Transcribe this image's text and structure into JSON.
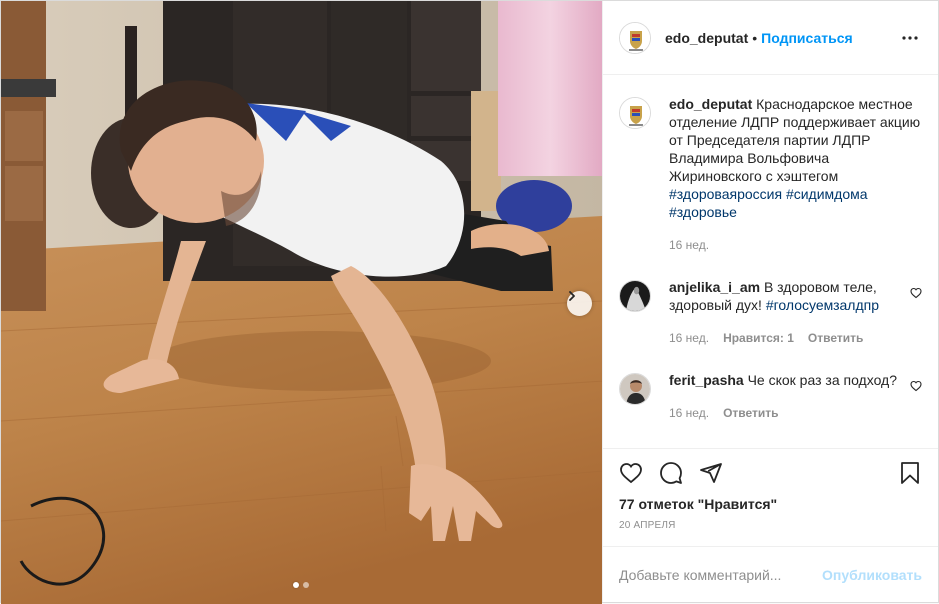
{
  "post": {
    "author": "edo_deputat",
    "separator": "•",
    "follow_label": "Подписаться",
    "more_icon": "more-horizontal-icon"
  },
  "caption": {
    "user": "edo_deputat",
    "text": "Краснодарское местное отделение ЛДПР поддерживает акцию от Председателя партии ЛДПР Владимира Вольфовича Жириновского с хэштегом",
    "hashtags": [
      "#здороваяроссия",
      "#сидимдома",
      "#здоровье"
    ],
    "time": "16 нед."
  },
  "comments": [
    {
      "user": "anjelika_i_am",
      "text": "В здоровом теле, здоровый дух!",
      "hashtag": "#голосуемзалдпр",
      "time": "16 нед.",
      "likes": "Нравится: 1",
      "reply": "Ответить"
    },
    {
      "user": "ferit_pasha",
      "text": "Че скок раз за подход?",
      "time": "16 нед.",
      "reply": "Ответить"
    }
  ],
  "likes_text": "77 отметок \"Нравится\"",
  "date": "20 апреля",
  "composer": {
    "placeholder": "Добавьте комментарий...",
    "publish_label": "Опубликовать"
  },
  "carousel": {
    "slides": 2,
    "current": 1
  },
  "colors": {
    "accent": "#0095f6",
    "publish_disabled": "#b2dffc",
    "hashtag": "#00376b",
    "meta": "#8e8e8e"
  }
}
